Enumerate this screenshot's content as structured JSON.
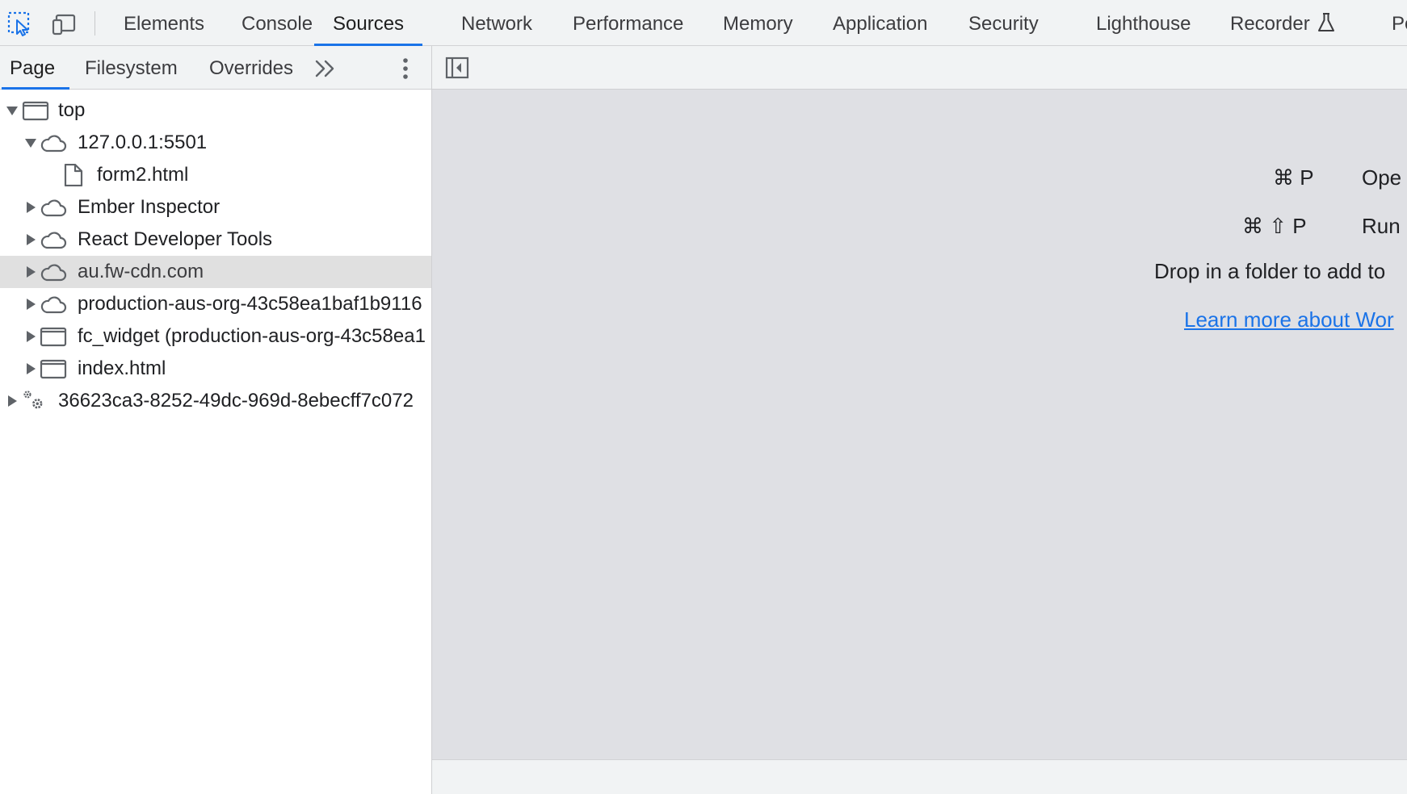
{
  "toolbar": {
    "inspect_icon": "inspect-element-icon",
    "device_icon": "device-toolbar-icon",
    "tabs": [
      {
        "label": "Elements"
      },
      {
        "label": "Console"
      },
      {
        "label": "Sources",
        "active": true
      },
      {
        "label": "Network"
      },
      {
        "label": "Performance"
      },
      {
        "label": "Memory"
      },
      {
        "label": "Application"
      },
      {
        "label": "Security"
      },
      {
        "label": "Lighthouse"
      },
      {
        "label": "Recorder"
      },
      {
        "label": "Pe"
      }
    ],
    "recorder_icon": "flask-icon"
  },
  "navigator": {
    "tabs": [
      {
        "label": "Page",
        "active": true
      },
      {
        "label": "Filesystem"
      },
      {
        "label": "Overrides"
      }
    ],
    "more_icon": "double-chevron-right-icon",
    "menu_icon": "kebab-menu-icon",
    "tree": [
      {
        "label": "top",
        "icon": "frame-icon",
        "expanded": true
      },
      {
        "label": "127.0.0.1:5501",
        "icon": "cloud-icon",
        "expanded": true
      },
      {
        "label": "form2.html",
        "icon": "file-icon"
      },
      {
        "label": "Ember Inspector",
        "icon": "cloud-icon"
      },
      {
        "label": "React Developer Tools",
        "icon": "cloud-icon"
      },
      {
        "label": "au.fw-cdn.com",
        "icon": "cloud-icon",
        "selected": true
      },
      {
        "label": "production-aus-org-43c58ea1baf1b9116",
        "icon": "cloud-icon"
      },
      {
        "label": "fc_widget (production-aus-org-43c58ea1",
        "icon": "frame-icon"
      },
      {
        "label": "index.html",
        "icon": "frame-icon"
      },
      {
        "label": "36623ca3-8252-49dc-969d-8ebecff7c072",
        "icon": "gears-icon"
      }
    ]
  },
  "editor": {
    "toggle_icon": "sidebar-toggle-icon",
    "shortcuts": [
      {
        "keys": "⌘ P",
        "action": "Ope"
      },
      {
        "keys": "⌘ ⇧ P",
        "action": "Run"
      }
    ],
    "drop_text": "Drop in a folder to add to",
    "learn_link": "Learn more about Wor"
  },
  "colors": {
    "accent": "#1a73e8",
    "toolbar_bg": "#f1f3f4",
    "editor_bg": "#dfe0e4",
    "selected_row": "#e0e0e0"
  }
}
